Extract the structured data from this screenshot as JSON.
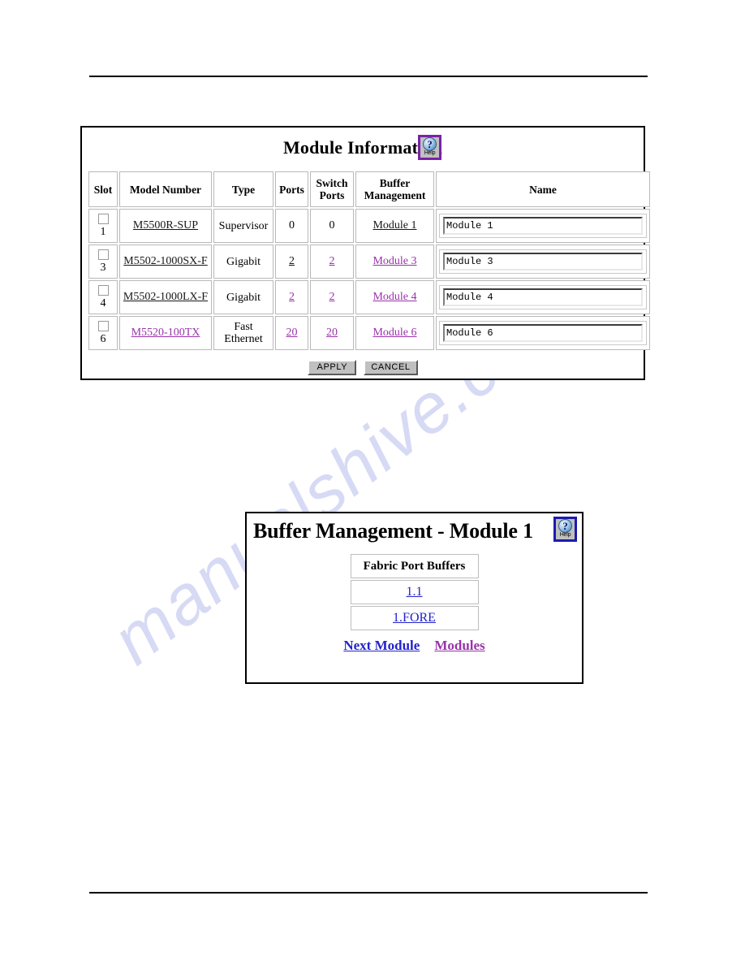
{
  "page": {
    "watermark": "manualshive.com"
  },
  "module_info": {
    "title": "Module Information",
    "help": {
      "label": "Help",
      "glyph": "?"
    },
    "columns": [
      "Slot",
      "Model Number",
      "Type",
      "Ports",
      "Switch Ports",
      "Buffer Management",
      "Name"
    ],
    "column_lines": {
      "switch_ports": [
        "Switch",
        "Ports"
      ],
      "buffer_management": [
        "Buffer",
        "Management"
      ]
    },
    "rows": [
      {
        "slot": "1",
        "checked": false,
        "model_number": "M5500R-SUP",
        "model_style": "black",
        "type": "Supervisor",
        "type_lines": [
          "Supervisor"
        ],
        "ports": "0",
        "ports_link": false,
        "switch_ports": "0",
        "switch_ports_link": false,
        "buffer_management": "Module 1",
        "buffer_style": "black",
        "name_value": "Module 1"
      },
      {
        "slot": "3",
        "checked": false,
        "model_number": "M5502-1000SX-F",
        "model_style": "black",
        "type": "Gigabit",
        "type_lines": [
          "Gigabit"
        ],
        "ports": "2",
        "ports_link": true,
        "ports_style": "black",
        "switch_ports": "2",
        "switch_ports_link": true,
        "switch_ports_style": "visited",
        "buffer_management": "Module 3",
        "buffer_style": "visited",
        "name_value": "Module 3"
      },
      {
        "slot": "4",
        "checked": false,
        "model_number": "M5502-1000LX-F",
        "model_style": "black",
        "type": "Gigabit",
        "type_lines": [
          "Gigabit"
        ],
        "ports": "2",
        "ports_link": true,
        "ports_style": "visited",
        "switch_ports": "2",
        "switch_ports_link": true,
        "switch_ports_style": "visited",
        "buffer_management": "Module 4",
        "buffer_style": "visited",
        "name_value": "Module 4"
      },
      {
        "slot": "6",
        "checked": false,
        "model_number": "M5520-100TX",
        "model_style": "visited",
        "type": "Fast Ethernet",
        "type_lines": [
          "Fast",
          "Ethernet"
        ],
        "ports": "20",
        "ports_link": true,
        "ports_style": "visited",
        "switch_ports": "20",
        "switch_ports_link": true,
        "switch_ports_style": "visited",
        "buffer_management": "Module 6",
        "buffer_style": "visited",
        "name_value": "Module 6"
      }
    ],
    "buttons": {
      "apply": "APPLY",
      "cancel": "CANCEL"
    }
  },
  "buffer_mgmt": {
    "title": "Buffer Management - Module 1",
    "help": {
      "label": "Help",
      "glyph": "?"
    },
    "table": {
      "header": "Fabric Port Buffers",
      "rows": [
        "1.1",
        "1.FORE"
      ]
    },
    "links": [
      {
        "label": "Next Module",
        "style": "blue"
      },
      {
        "label": "Modules",
        "style": "visited"
      }
    ]
  },
  "colors": {
    "link_blue": "#2222cc",
    "link_visited": "#9933aa",
    "link_black": "#171717",
    "help_border_purple": "#7a22a8",
    "help_border_navy": "#1b1bb0",
    "button_face": "#c0c0c0",
    "watermark": "#c9cdf0"
  }
}
